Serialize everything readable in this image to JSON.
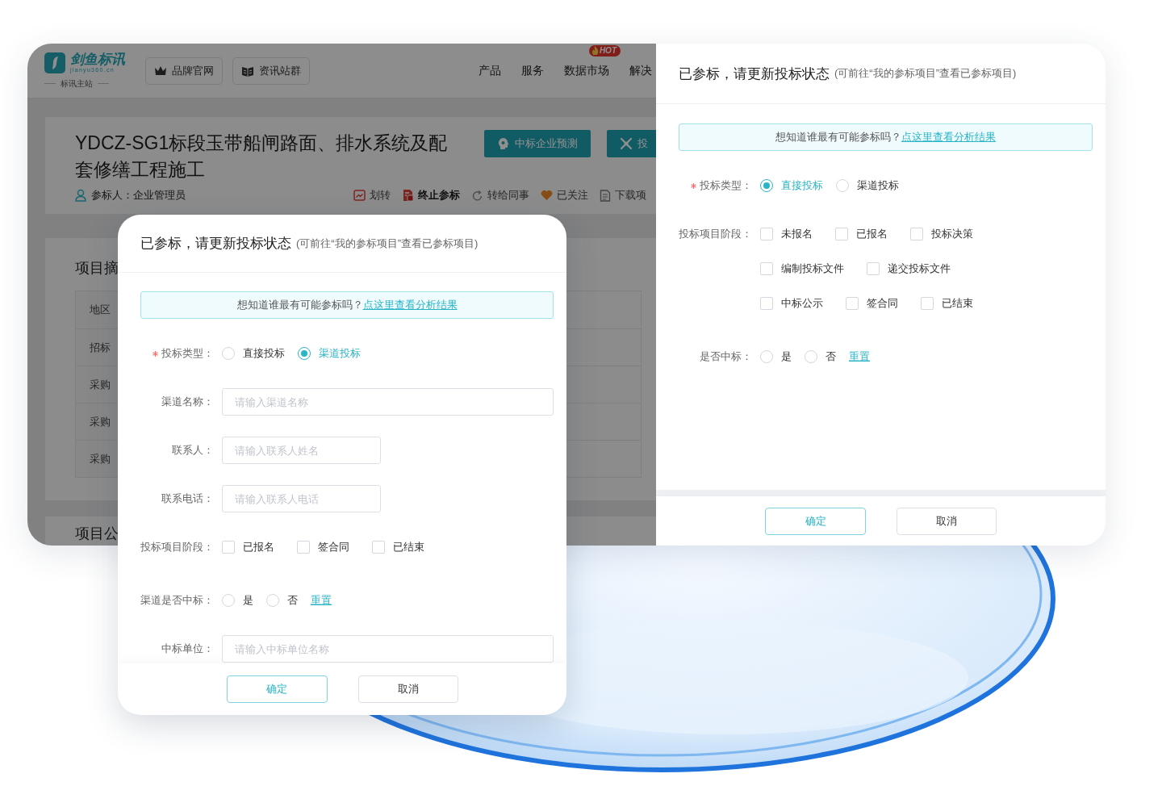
{
  "website": {
    "logo": {
      "name": "剑鱼标讯",
      "domain": "jianyu360.cn",
      "subtitle": "标讯主站"
    },
    "header_links": [
      {
        "label": "品牌官网",
        "kind": "crown"
      },
      {
        "label": "资讯站群",
        "kind": "book"
      }
    ],
    "nav": [
      {
        "label": "产品"
      },
      {
        "label": "服务"
      },
      {
        "label": "数据市场",
        "badge": "HOT"
      },
      {
        "label": "解决"
      }
    ],
    "project": {
      "title": "YDCZ-SG1标段玉带船闸路面、排水系统及配套修缮工程施工",
      "buttons": [
        {
          "label": "中标企业预测",
          "kind": "ai"
        },
        {
          "label": "投",
          "kind": "network"
        }
      ],
      "participant": "参标人：企业管理员",
      "actions": [
        {
          "label": "划转",
          "kind": "transfer"
        },
        {
          "label": "终止参标",
          "kind": "stop"
        },
        {
          "label": "转给同事",
          "kind": "forward"
        },
        {
          "label": "已关注",
          "kind": "follow"
        },
        {
          "label": "下载项",
          "kind": "download"
        }
      ]
    },
    "summary": {
      "title": "项目摘",
      "rows": [
        "地区",
        "招标",
        "采购",
        "采购",
        "采购"
      ]
    },
    "next_section": {
      "title": "项目公"
    }
  },
  "dialogs": [
    {
      "title": "已参标，请更新投标状态",
      "subtitle": "(可前往“我的参标项目”查看已参标项目)",
      "alert": "想知道谁最有可能参标吗？",
      "alert_link": "点这里查看分析结果",
      "fields": [
        {
          "kind": "radio",
          "label": "投标类型：",
          "required": true,
          "options": [
            {
              "label": "直接投标",
              "selected": false
            },
            {
              "label": "渠道投标",
              "selected": true
            }
          ]
        },
        {
          "kind": "input",
          "label": "渠道名称：",
          "required": false,
          "placeholder": "请输入渠道名称",
          "wide": true
        },
        {
          "kind": "input",
          "label": "联系人：",
          "required": false,
          "placeholder": "请输入联系人姓名",
          "wide": false
        },
        {
          "kind": "input",
          "label": "联系电话：",
          "required": false,
          "placeholder": "请输入联系人电话",
          "wide": false
        },
        {
          "kind": "checkbox",
          "label": "投标项目阶段：",
          "required": false,
          "rows": [
            {
              "options": [
                {
                  "label": "已报名",
                  "checked": false
                },
                {
                  "label": "签合同",
                  "checked": false
                },
                {
                  "label": "已结束",
                  "checked": false
                }
              ]
            }
          ]
        },
        {
          "kind": "radio",
          "label": "渠道是否中标：",
          "required": false,
          "options": [
            {
              "label": "是",
              "selected": false
            },
            {
              "label": "否",
              "selected": false
            }
          ],
          "reset": "重置"
        },
        {
          "kind": "input",
          "label": "中标单位：",
          "required": false,
          "placeholder": "请输入中标单位名称",
          "wide": true
        }
      ],
      "buttons": [
        {
          "label": "确定",
          "primary": true
        },
        {
          "label": "取消",
          "primary": false
        }
      ]
    },
    {
      "title": "已参标，请更新投标状态",
      "subtitle": "(可前往“我的参标项目”查看已参标项目)",
      "alert": "想知道谁最有可能参标吗？",
      "alert_link": "点这里查看分析结果",
      "fields": [
        {
          "kind": "radio",
          "label": "投标类型：",
          "required": true,
          "options": [
            {
              "label": "直接投标",
              "selected": true
            },
            {
              "label": "渠道投标",
              "selected": false
            }
          ]
        },
        {
          "kind": "checkbox",
          "label": "投标项目阶段：",
          "required": false,
          "rows": [
            {
              "options": [
                {
                  "label": "未报名",
                  "checked": false
                },
                {
                  "label": "已报名",
                  "checked": false
                },
                {
                  "label": "投标决策",
                  "checked": false
                }
              ]
            },
            {
              "options": [
                {
                  "label": "编制投标文件",
                  "checked": false
                },
                {
                  "label": "递交投标文件",
                  "checked": false
                }
              ]
            },
            {
              "options": [
                {
                  "label": "中标公示",
                  "checked": false
                },
                {
                  "label": "签合同",
                  "checked": false
                },
                {
                  "label": "已结束",
                  "checked": false
                }
              ]
            }
          ]
        },
        {
          "kind": "radio",
          "label": "是否中标：",
          "required": false,
          "options": [
            {
              "label": "是",
              "selected": false
            },
            {
              "label": "否",
              "selected": false
            }
          ],
          "reset": "重置"
        }
      ],
      "buttons": [
        {
          "label": "确定",
          "primary": true
        },
        {
          "label": "取消",
          "primary": false
        }
      ]
    }
  ]
}
